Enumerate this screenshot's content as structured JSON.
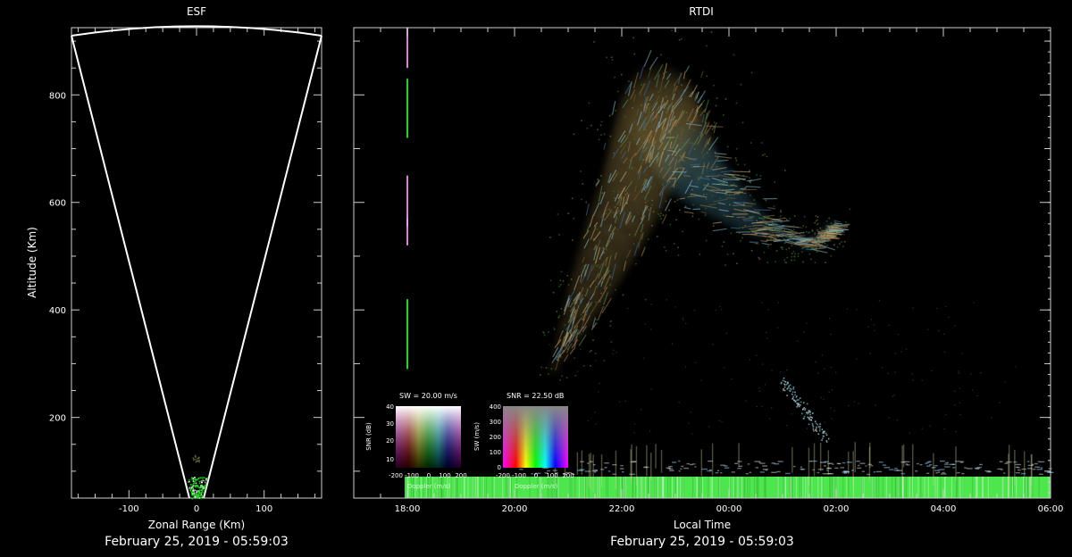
{
  "chart_data": [
    {
      "type": "heatmap",
      "title": "ESF",
      "xlabel": "Zonal Range (Km)",
      "ylabel": "Altitude (Km)",
      "xlim": [
        -185,
        185
      ],
      "ylim": [
        50,
        925
      ],
      "x_ticks": [
        -100,
        0,
        100
      ],
      "y_ticks": [
        200,
        400,
        600,
        800
      ],
      "timestamp": "February 25, 2019 - 05:59:03",
      "scan_sector": {
        "apex": [
          0,
          50
        ],
        "left_edge": [
          -185,
          910
        ],
        "right_edge": [
          185,
          910
        ],
        "arc_top": 922
      },
      "echo": {
        "x_range": [
          -18,
          14
        ],
        "y_range": [
          50,
          90
        ],
        "color": "#22dd22"
      }
    },
    {
      "type": "heatmap",
      "title": "RTDI",
      "xlabel": "Local Time",
      "timestamp": "February 25, 2019 - 05:59:03",
      "x_ticks": [
        "18:00",
        "20:00",
        "22:00",
        "00:00",
        "02:00",
        "04:00",
        "06:00"
      ],
      "x_tick_hours": [
        18,
        20,
        22,
        24,
        26,
        28,
        30
      ],
      "xlim_hours": [
        17,
        30
      ],
      "ylim": [
        50,
        925
      ],
      "y_ticks": [
        200,
        400,
        600,
        800
      ],
      "background_band": {
        "y_range": [
          50,
          90
        ],
        "color": "#55ff55"
      },
      "plume_path": [
        {
          "t": 20.75,
          "alt": 295
        },
        {
          "t": 21.5,
          "alt": 460
        },
        {
          "t": 22.3,
          "alt": 640
        },
        {
          "t": 22.7,
          "alt": 780
        },
        {
          "t": 23.3,
          "alt": 660
        },
        {
          "t": 24.5,
          "alt": 560
        },
        {
          "t": 25.5,
          "alt": 520
        },
        {
          "t": 26.0,
          "alt": 560
        }
      ],
      "legends": [
        {
          "title": "SW = 20.00 m/s",
          "ylabel": "SNR (dB)",
          "xlabel": "Doppler (m/s)",
          "y_ticks": [
            "40",
            "30",
            "20",
            "10"
          ],
          "x_ticks": [
            "-200",
            "-100",
            "0",
            "100",
            "200"
          ]
        },
        {
          "title": "SNR = 22.50 dB",
          "ylabel": "SW (m/s)",
          "xlabel": "Doppler (m/s)",
          "y_ticks": [
            "400",
            "300",
            "200",
            "100",
            "0"
          ],
          "x_ticks": [
            "-200",
            "-100",
            "0",
            "100",
            "200"
          ]
        }
      ]
    }
  ]
}
